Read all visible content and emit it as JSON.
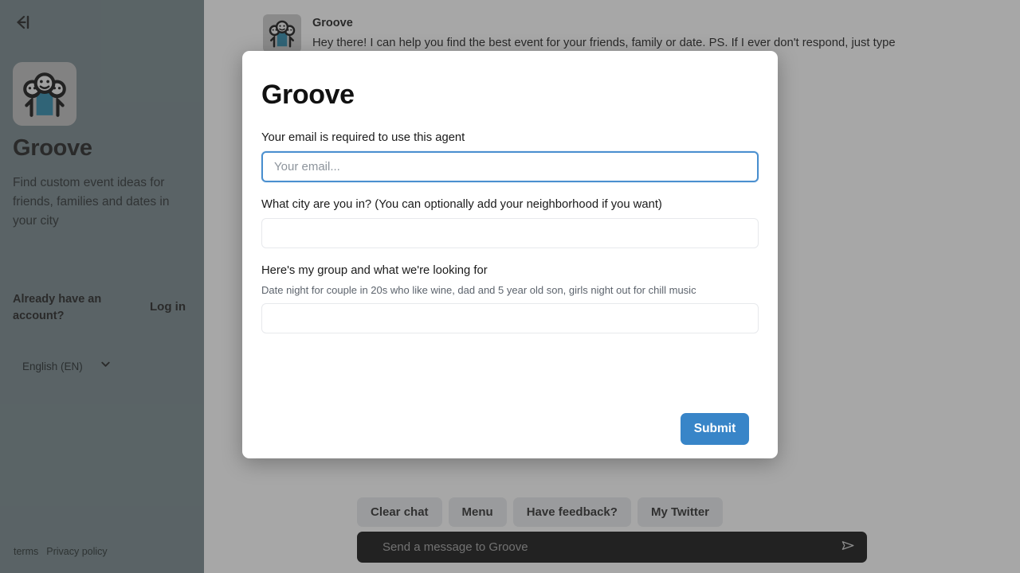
{
  "sidebar": {
    "collapse_icon": "collapse-left-arrow-icon",
    "logo_icon": "three-people-group-icon",
    "title": "Groove",
    "description": "Find custom event ideas for friends, families and dates in your city",
    "account_question": "Already have an account?",
    "login_label": "Log in",
    "language": {
      "selected": "English (EN)",
      "chevron_icon": "chevron-down-icon"
    },
    "legal": {
      "terms": "terms",
      "privacy": "Privacy policy"
    }
  },
  "chat": {
    "avatar_icon": "three-people-group-icon",
    "sender": "Groove",
    "message": "Hey there! I can help you find the best event for your friends, family or date. PS. If I ever don't respond, just type",
    "quick_actions": [
      {
        "label": "Clear chat",
        "name": "clear-chat-button"
      },
      {
        "label": "Menu",
        "name": "menu-button"
      },
      {
        "label": "Have feedback?",
        "name": "feedback-button"
      },
      {
        "label": "My Twitter",
        "name": "twitter-button"
      }
    ],
    "composer": {
      "placeholder": "Send a message to Groove",
      "send_icon": "send-paper-plane-icon"
    }
  },
  "modal": {
    "title": "Groove",
    "fields": [
      {
        "label": "Your email is required to use this agent",
        "placeholder": "Your email...",
        "value": "",
        "hint": "",
        "focused": true
      },
      {
        "label": "What city are you in? (You can optionally add your neighborhood if you want)",
        "placeholder": "",
        "value": "",
        "hint": "",
        "focused": false
      },
      {
        "label": "Here's my group and what we're looking for",
        "placeholder": "",
        "value": "",
        "hint": "Date night for couple in 20s who like wine, dad and 5 year old son, girls night out for chill music",
        "focused": false
      }
    ],
    "submit_label": "Submit"
  },
  "colors": {
    "sidebar_bg": "#6b7d82",
    "accent_blue": "#3885c8",
    "focus_border": "#4a8fcf",
    "composer_bg": "#000000",
    "quick_btn_bg": "#e7e9eb"
  }
}
